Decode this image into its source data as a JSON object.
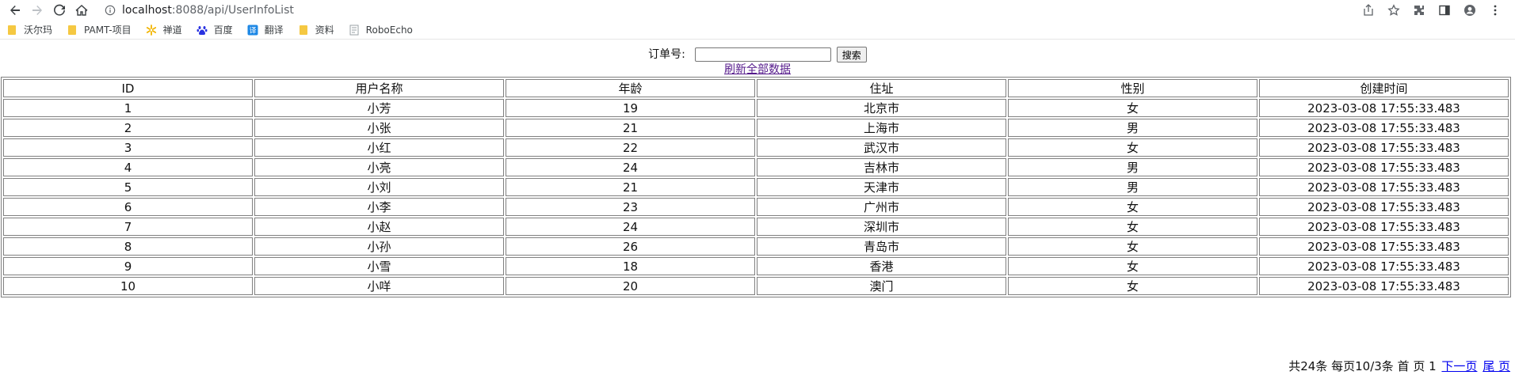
{
  "browser": {
    "url_host": "localhost",
    "url_path": ":8088/api/UserInfoList"
  },
  "bookmarks": [
    {
      "label": "沃尔玛",
      "icon": "folder-icon"
    },
    {
      "label": "PAMT-项目",
      "icon": "folder-icon"
    },
    {
      "label": "禅道",
      "icon": "spark-icon"
    },
    {
      "label": "百度",
      "icon": "baidu-paw-icon"
    },
    {
      "label": "翻译",
      "icon": "translate-icon"
    },
    {
      "label": "资料",
      "icon": "folder-icon"
    },
    {
      "label": "RoboEcho",
      "icon": "document-icon"
    }
  ],
  "search": {
    "label": "订单号:",
    "value": "",
    "button_label": "搜索"
  },
  "refresh_link": "刷新全部数据",
  "table": {
    "headers": [
      "ID",
      "用户名称",
      "年龄",
      "住址",
      "性别",
      "创建时间"
    ],
    "rows": [
      [
        "1",
        "小芳",
        "19",
        "北京市",
        "女",
        "2023-03-08 17:55:33.483"
      ],
      [
        "2",
        "小张",
        "21",
        "上海市",
        "男",
        "2023-03-08 17:55:33.483"
      ],
      [
        "3",
        "小红",
        "22",
        "武汉市",
        "女",
        "2023-03-08 17:55:33.483"
      ],
      [
        "4",
        "小亮",
        "24",
        "吉林市",
        "男",
        "2023-03-08 17:55:33.483"
      ],
      [
        "5",
        "小刘",
        "21",
        "天津市",
        "男",
        "2023-03-08 17:55:33.483"
      ],
      [
        "6",
        "小李",
        "23",
        "广州市",
        "女",
        "2023-03-08 17:55:33.483"
      ],
      [
        "7",
        "小赵",
        "24",
        "深圳市",
        "女",
        "2023-03-08 17:55:33.483"
      ],
      [
        "8",
        "小孙",
        "26",
        "青岛市",
        "女",
        "2023-03-08 17:55:33.483"
      ],
      [
        "9",
        "小雪",
        "18",
        "香港",
        "女",
        "2023-03-08 17:55:33.483"
      ],
      [
        "10",
        "小咩",
        "20",
        "澳门",
        "女",
        "2023-03-08 17:55:33.483"
      ]
    ]
  },
  "pager": {
    "summary": "共24条 每页10/3条 首 页 1",
    "next_label": "下一页",
    "last_label": "尾 页"
  }
}
